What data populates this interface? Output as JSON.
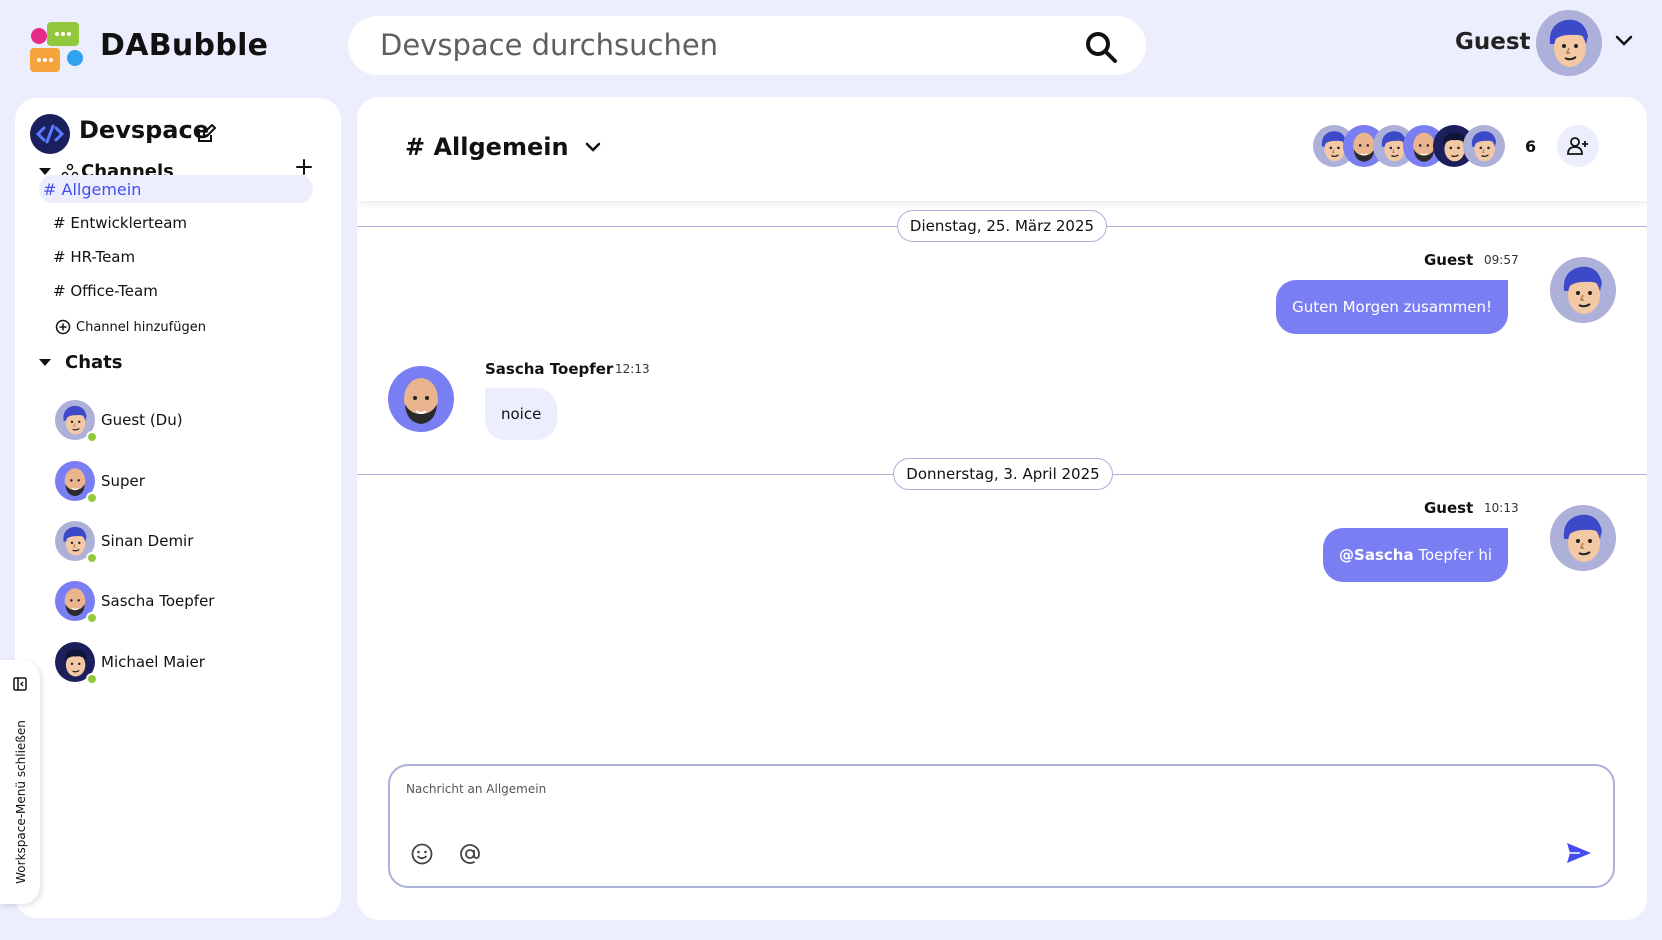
{
  "colors": {
    "accent": "#444df2",
    "bubble_own": "#797ef3",
    "bubble_other": "#eceefe",
    "online": "#92c83e",
    "background": "#eceefe"
  },
  "header": {
    "brand": "DABubble",
    "search_placeholder": "Devspace durchsuchen",
    "user_name": "Guest",
    "icons": [
      "logo-icon",
      "search-icon",
      "avatar",
      "chevron-down-icon"
    ]
  },
  "sidebar": {
    "workspace_title": "Devspace",
    "channels_label": "Channels",
    "channels": [
      {
        "label": "# Allgemein",
        "active": true
      },
      {
        "label": "# Entwicklerteam",
        "active": false
      },
      {
        "label": "# HR-Team",
        "active": false
      },
      {
        "label": "# Office-Team",
        "active": false
      }
    ],
    "add_channel_label": "Channel hinzufügen",
    "chats_label": "Chats",
    "chats": [
      {
        "name": "Guest (Du)",
        "online": true
      },
      {
        "name": "Super",
        "online": true
      },
      {
        "name": "Sinan Demir",
        "online": true
      },
      {
        "name": "Sascha Toepfer",
        "online": true
      },
      {
        "name": "Michael Maier",
        "online": true
      }
    ],
    "toggle_label": "Workspace-Menü schließen"
  },
  "channel": {
    "title": "# Allgemein",
    "member_count": "6"
  },
  "messages": {
    "date1": "Dienstag, 25. März 2025",
    "date2": "Donnerstag, 3. April 2025",
    "m1": {
      "author": "Guest",
      "time": "09:57",
      "text": "Guten Morgen zusammen!"
    },
    "m2": {
      "author": "Sascha Toepfer",
      "time": "12:13",
      "text": "noice"
    },
    "m3": {
      "author": "Guest",
      "time": "10:13",
      "mention": "@Sascha",
      "text": " Toepfer hi"
    }
  },
  "composer": {
    "placeholder": "Nachricht an Allgemein"
  }
}
